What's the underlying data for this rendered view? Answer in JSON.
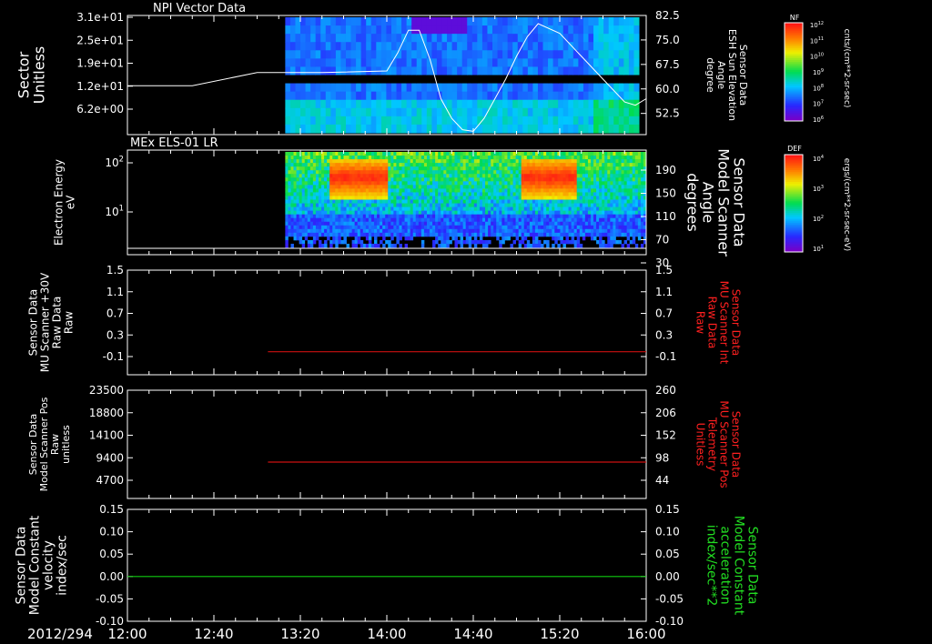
{
  "colors": {
    "background": "#000000",
    "foreground": "#ffffff",
    "red_trace": "#cc1111",
    "green_trace": "#11cc11",
    "red_label": "#ff2020",
    "green_label": "#22dd22"
  },
  "time_axis": {
    "date_label": "2012/294",
    "ticks": [
      "12:00",
      "12:40",
      "13:20",
      "14:00",
      "14:40",
      "15:20",
      "16:00"
    ],
    "start": "12:00",
    "end": "16:00"
  },
  "chart_data": [
    {
      "type": "heatmap",
      "title": "NPI Vector Data",
      "ylabel": "Sector\nUnitless",
      "yticks": [
        "3.1e+01",
        "2.5e+01",
        "1.9e+01",
        "1.2e+01",
        "6.2e+00"
      ],
      "ylabel_right": "Sensor Data\nESH Sun Elevation\nAngle\ndegree",
      "yticks_right": [
        "82.5",
        "75.0",
        "67.5",
        "60.0",
        "52.5"
      ],
      "y2lim": [
        46,
        82.5
      ],
      "colorbar": {
        "label": "NF",
        "title": "cnts/(cm**2-sr-sec)",
        "ticks": [
          "10^12",
          "10^11",
          "10^10",
          "10^9",
          "10^8",
          "10^7",
          "10^6"
        ],
        "colormap": "rainbow"
      },
      "data_start": "13:13",
      "overlay_line": {
        "times": [
          "12:00",
          "12:30",
          "13:00",
          "13:30",
          "14:00",
          "14:05",
          "14:10",
          "14:15",
          "14:20",
          "14:25",
          "14:30",
          "14:35",
          "14:40",
          "14:45",
          "14:50",
          "14:55",
          "15:00",
          "15:05",
          "15:10",
          "15:20",
          "15:30",
          "15:40",
          "15:50",
          "15:55",
          "16:00"
        ],
        "values": [
          61,
          61,
          65,
          65,
          65.5,
          71,
          78,
          78,
          69,
          57,
          51,
          47.5,
          47,
          51,
          57,
          63,
          70,
          76,
          80,
          77,
          70,
          63,
          56,
          55,
          57
        ]
      }
    },
    {
      "type": "heatmap",
      "title": "MEx ELS-01 LR",
      "ylabel": "Electron Energy\neV",
      "yticks": [
        "10^2",
        "10^1"
      ],
      "ylabel_right": "Sensor Data\nModel Scanner\nAngle\ndegrees",
      "yticks_right": [
        "190",
        "150",
        "110",
        "70",
        "30"
      ],
      "colorbar": {
        "label": "DEF",
        "title": "ergs/(cm**2-sr-sec-eV)",
        "ticks": [
          "10^4",
          "10^3",
          "10^2",
          "10^1"
        ],
        "colormap": "rainbow"
      },
      "data_start": "13:13",
      "data_end": "16:00",
      "hot_regions": [
        {
          "start": "13:33",
          "end": "14:00"
        },
        {
          "start": "15:02",
          "end": "15:27"
        }
      ],
      "overlay_line": {
        "times": [
          "12:00",
          "16:00"
        ],
        "values": [
          3,
          3
        ]
      }
    },
    {
      "type": "line",
      "ylabel": "Sensor Data\nMU Scanner +30V\nRaw Data\nRaw",
      "yticks": [
        "1.5",
        "1.1",
        "0.7",
        "0.3",
        "-0.1"
      ],
      "ylim": [
        -0.5,
        1.5
      ],
      "ylabel_right": "Sensor Data\nMU Scanner Int\nRaw Data\nRaw",
      "yticks_right": [
        "1.5",
        "1.1",
        "0.7",
        "0.3",
        "-0.1"
      ],
      "series": [
        {
          "color": "red",
          "start": "13:05",
          "end": "16:00",
          "value": -0.06
        }
      ]
    },
    {
      "type": "line",
      "ylabel": "Sensor Data\nModel Scanner Pos\nRaw\nunitless",
      "yticks": [
        "23500",
        "18800",
        "14100",
        "9400",
        "4700"
      ],
      "ylim": [
        0,
        23500
      ],
      "ylabel_right": "Sensor Data\nMU Scanner Pos\nTelemetry\nUnitless",
      "yticks_right": [
        "260",
        "206",
        "152",
        "98",
        "44"
      ],
      "series": [
        {
          "color": "red",
          "start": "13:05",
          "end": "16:00",
          "value": 7900
        }
      ]
    },
    {
      "type": "line",
      "ylabel": "Sensor Data\nModel Constant\nvelocity\nindex/sec",
      "yticks": [
        "0.15",
        "0.10",
        "0.05",
        "0.00",
        "-0.05",
        "-0.10"
      ],
      "ylim": [
        -0.1,
        0.15
      ],
      "ylabel_right": "Sensor Data\nModel Constant\nacceleration\nindex/sec**2",
      "yticks_right": [
        "0.15",
        "0.10",
        "0.05",
        "0.00",
        "-0.05",
        "-0.10"
      ],
      "series": [
        {
          "color": "green",
          "start": "12:00",
          "end": "16:00",
          "value": 0.0
        }
      ]
    }
  ]
}
